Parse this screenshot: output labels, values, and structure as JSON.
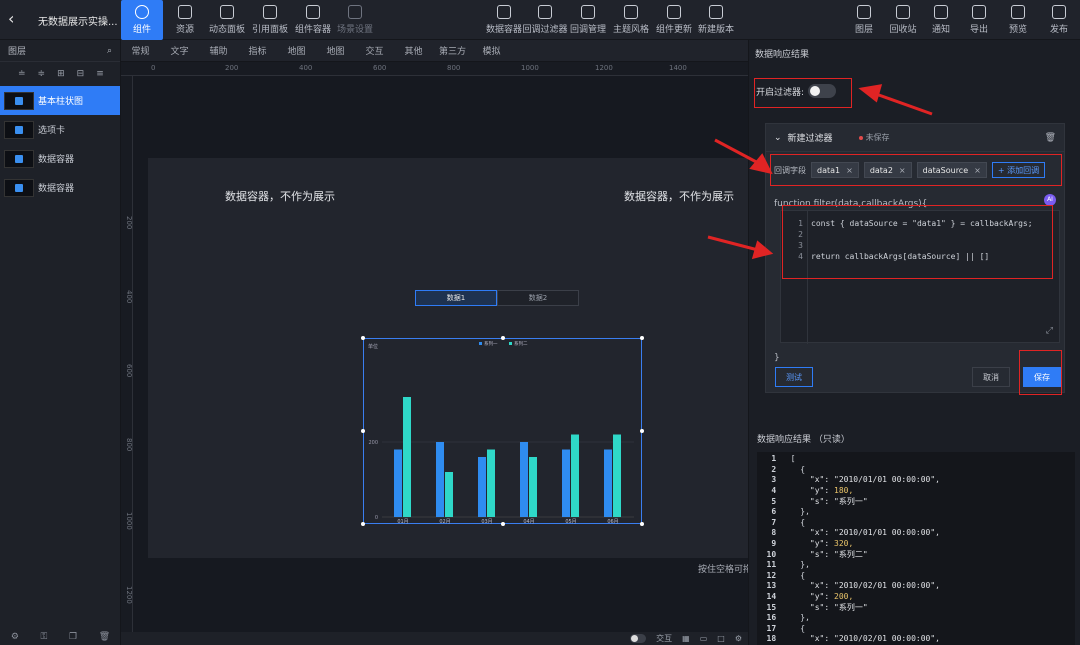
{
  "app": {
    "title": "无数据展示实操..."
  },
  "toolbar_left": [
    {
      "name": "tb-component",
      "label": "组件",
      "active": true
    },
    {
      "name": "tb-resource",
      "label": "资源"
    },
    {
      "name": "tb-dynamic-panel",
      "label": "动态面板"
    },
    {
      "name": "tb-ref-panel",
      "label": "引用面板"
    },
    {
      "name": "tb-component-container",
      "label": "组件容器"
    },
    {
      "name": "tb-scene-settings",
      "label": "场景设置",
      "dim": true
    }
  ],
  "toolbar_mid": [
    {
      "name": "tb-data-container",
      "label": "数据容器"
    },
    {
      "name": "tb-global-filter",
      "label": "回调过滤器"
    },
    {
      "name": "tb-callback-mgmt",
      "label": "回调管理"
    },
    {
      "name": "tb-theme",
      "label": "主题风格"
    },
    {
      "name": "tb-component-update",
      "label": "组件更新"
    },
    {
      "name": "tb-new-version",
      "label": "新建版本"
    }
  ],
  "toolbar_right": [
    {
      "name": "tb-layers",
      "label": "图层"
    },
    {
      "name": "tb-recycle",
      "label": "回收站"
    },
    {
      "name": "tb-notify",
      "label": "通知"
    },
    {
      "name": "tb-export",
      "label": "导出"
    },
    {
      "name": "tb-preview",
      "label": "预览"
    },
    {
      "name": "tb-publish",
      "label": "发布"
    }
  ],
  "left_panel": {
    "title": "图层",
    "tools": [
      "≐",
      "≑",
      "⊞",
      "⊟",
      "≡"
    ],
    "layers": [
      {
        "label": "基本柱状图",
        "selected": true
      },
      {
        "label": "选项卡"
      },
      {
        "label": "数据容器"
      },
      {
        "label": "数据容器"
      }
    ]
  },
  "category_tabs": [
    "常规",
    "文字",
    "辅助",
    "指标",
    "地图",
    "地图",
    "交互",
    "其他",
    "第三方",
    "模拟"
  ],
  "ruler_top": [
    "0",
    "200",
    "400",
    "600",
    "800",
    "1000",
    "1200",
    "1400"
  ],
  "ruler_left": [
    "200",
    "400",
    "600",
    "800",
    "1000",
    "1200"
  ],
  "canvas": {
    "container_label_left": "数据容器，不作为展示",
    "container_label_right": "数据容器，不作为展示",
    "tab1": "数据1",
    "tab2": "数据2",
    "hint": "按住空格可拖"
  },
  "bottom_bar": {
    "label": "交互"
  },
  "chart_data": {
    "type": "bar",
    "title": "",
    "categories": [
      "01月",
      "02月",
      "03月",
      "04月",
      "05月",
      "06月"
    ],
    "series": [
      {
        "name": "系列一",
        "values": [
          180,
          200,
          160,
          200,
          180,
          180
        ],
        "color": "#2f8cf0"
      },
      {
        "name": "系列二",
        "values": [
          320,
          120,
          180,
          160,
          220,
          220
        ],
        "color": "#2fd8c8"
      }
    ],
    "ylabel": "单位",
    "yticks": [
      "0",
      "200"
    ],
    "ylim": [
      0,
      400
    ],
    "legend": "top-center",
    "grid": true
  },
  "right_panel": {
    "title": "数据响应结果",
    "filter_toggle_label": "开启过滤器:",
    "filter_enabled": false,
    "card_title": "新建过滤器",
    "unsaved": "未保存",
    "field_label": "回调字段",
    "fields": [
      "data1",
      "data2",
      "dataSource"
    ],
    "add_callback": "+ 添加回调",
    "fn_signature": "function filter(data,callbackArgs){",
    "code_lines": [
      {
        "n": "1",
        "text": "const { dataSource = \"data1\" } = callbackArgs;"
      },
      {
        "n": "2",
        "text": ""
      },
      {
        "n": "3",
        "text": ""
      },
      {
        "n": "4",
        "text": "return callbackArgs[dataSource] || []"
      }
    ],
    "close_brace": "}",
    "test_btn": "测试",
    "cancel_btn": "取消",
    "save_btn": "保存",
    "response_title": "数据响应结果 （只读）",
    "response_lines": [
      {
        "n": "1",
        "t": "["
      },
      {
        "n": "2",
        "t": "  {"
      },
      {
        "n": "3",
        "k": "    \"x\": ",
        "s": "\"2010/01/01 00:00:00\","
      },
      {
        "n": "4",
        "k": "    \"y\": ",
        "v": "180,"
      },
      {
        "n": "5",
        "k": "    \"s\": ",
        "s": "\"系列一\""
      },
      {
        "n": "6",
        "t": "  },"
      },
      {
        "n": "7",
        "t": "  {"
      },
      {
        "n": "8",
        "k": "    \"x\": ",
        "s": "\"2010/01/01 00:00:00\","
      },
      {
        "n": "9",
        "k": "    \"y\": ",
        "v": "320,"
      },
      {
        "n": "10",
        "k": "    \"s\": ",
        "s": "\"系列二\""
      },
      {
        "n": "11",
        "t": "  },"
      },
      {
        "n": "12",
        "t": "  {"
      },
      {
        "n": "13",
        "k": "    \"x\": ",
        "s": "\"2010/02/01 00:00:00\","
      },
      {
        "n": "14",
        "k": "    \"y\": ",
        "v": "200,"
      },
      {
        "n": "15",
        "k": "    \"s\": ",
        "s": "\"系列一\""
      },
      {
        "n": "16",
        "t": "  },"
      },
      {
        "n": "17",
        "t": "  {"
      },
      {
        "n": "18",
        "k": "    \"x\": ",
        "s": "\"2010/02/01 00:00:00\","
      }
    ]
  }
}
